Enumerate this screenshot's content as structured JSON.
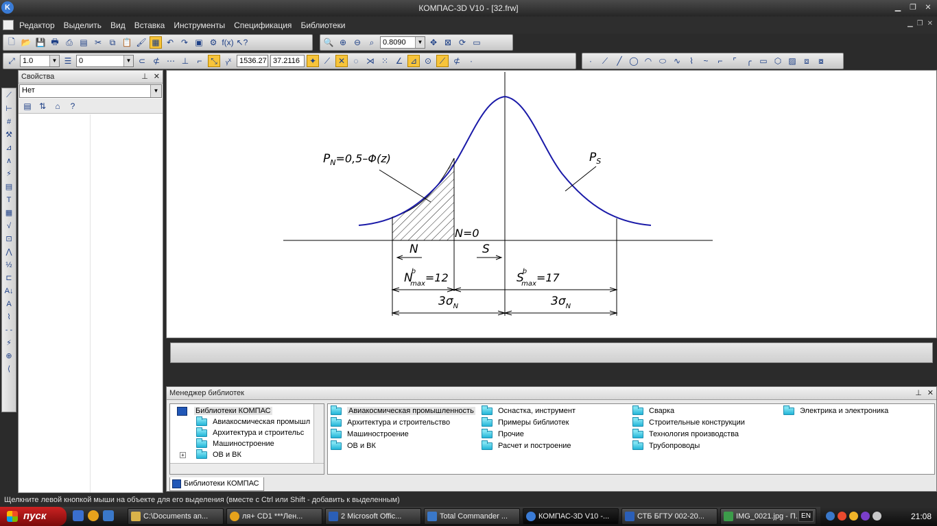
{
  "window": {
    "app_icon": "kompas-icon",
    "title": "КОМПАС-3D V10 - [32.frw]"
  },
  "menu": {
    "items": [
      "Редактор",
      "Выделить",
      "Вид",
      "Вставка",
      "Инструменты",
      "Спецификация",
      "Библиотеки"
    ]
  },
  "toolbar1": {
    "zoom_value": "0.8090"
  },
  "toolbar2": {
    "step_value": "1.0",
    "layer_value": "0",
    "coord_x": "1536.27",
    "coord_y": "37.2116"
  },
  "properties": {
    "title": "Свойства",
    "selected_object": "Нет"
  },
  "drawing": {
    "label_pn": "P",
    "label_pn_sub": "N",
    "label_pn_formula": "=0,5–Φ(z)",
    "label_ps": "P",
    "label_ps_sub": "S",
    "label_n0": "N=0",
    "label_n": "N",
    "label_s": "S",
    "label_nmax": "N",
    "label_nmax_sup": "b",
    "label_nmax_sub": "max",
    "label_nmax_val": "=12",
    "label_smax": "S",
    "label_smax_sup": "b",
    "label_smax_sub": "max",
    "label_smax_val": "=17",
    "label_3sigma_left": "3σ",
    "label_3sigma_left_sub": "N",
    "label_3sigma_right": "3σ",
    "label_3sigma_right_sub": "N",
    "curve_color": "#1a1aa8"
  },
  "library_manager": {
    "title": "Менеджер библиотек",
    "tree_root": "Библиотеки КОМПАС",
    "tree_items": [
      "Авиакосмическая промышл",
      "Архитектура и строительс",
      "Машиностроение",
      "ОВ и ВК"
    ],
    "columns": [
      [
        "Авиакосмическая промышленность",
        "Архитектура и строительство",
        "Машиностроение",
        "ОВ и ВК"
      ],
      [
        "Оснастка, инструмент",
        "Примеры библиотек",
        "Прочие",
        "Расчет и построение"
      ],
      [
        "Сварка",
        "Строительные конструкции",
        "Технология производства",
        "Трубопроводы"
      ],
      [
        "Электрика и электроника"
      ]
    ],
    "tab_label": "Библиотеки КОМПАС"
  },
  "status": {
    "message": "Щелкните левой кнопкой мыши на объекте для его выделения (вместе с Ctrl или Shift - добавить к выделенным)"
  },
  "taskbar": {
    "start_label": "пуск",
    "tasks": [
      {
        "label": "C:\\Documents an...",
        "color": "#d9b34a"
      },
      {
        "label": "ля+ CD1 ***Лен...",
        "color": "#e6a21c"
      },
      {
        "label": "2 Microsoft Offic...",
        "color": "#2b5fb8"
      },
      {
        "label": "Total Commander ...",
        "color": "#3a78c9"
      },
      {
        "label": "КОМПАС-3D V10 -...",
        "color": "#3a7bd5"
      },
      {
        "label": "СТБ БГТУ 002-20...",
        "color": "#2b5fb8"
      },
      {
        "label": "IMG_0021.jpg - П...",
        "color": "#3c9c4a"
      }
    ],
    "language": "EN",
    "clock": "21:08"
  }
}
